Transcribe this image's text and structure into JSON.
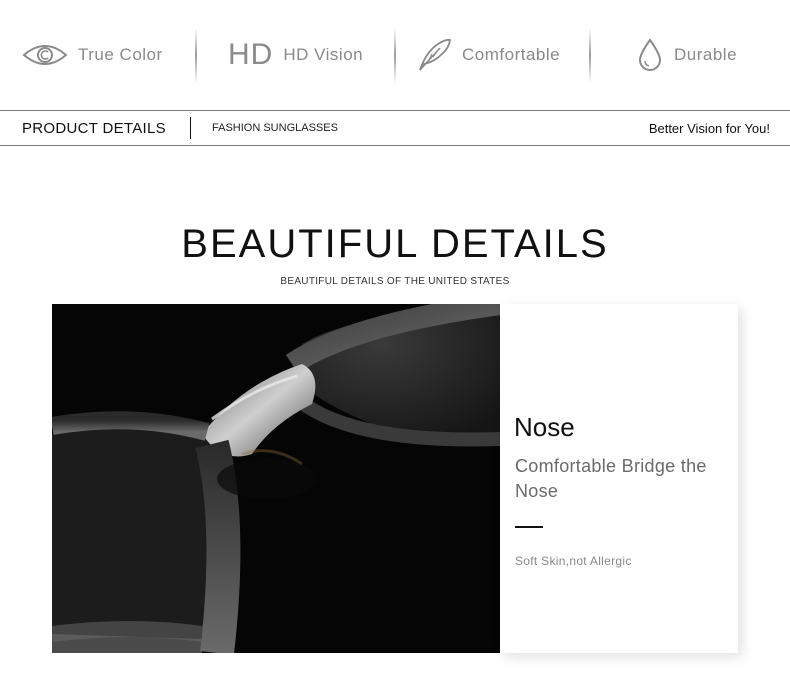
{
  "features": [
    {
      "icon": "eye-icon",
      "label": "True Color"
    },
    {
      "icon": "hd-icon",
      "icon_text": "HD",
      "label": "HD Vision"
    },
    {
      "icon": "feather-icon",
      "label": "Comfortable"
    },
    {
      "icon": "droplet-icon",
      "label": "Durable"
    }
  ],
  "bar": {
    "product_details": "PRODUCT DETAILS",
    "category": "FASHION SUNGLASSES",
    "slogan": "Better Vision for You!"
  },
  "section": {
    "title": "BEAUTIFUL DETAILS",
    "subtitle": "BEAUTIFUL DETAILS OF THE UNITED STATES"
  },
  "card": {
    "title": "Nose",
    "description": "Comfortable Bridge the Nose",
    "note": "Soft Skin,not Allergic"
  },
  "colors": {
    "icon_gray": "#8a8a8a",
    "text_dark": "#111111",
    "photo_bg": "#050505"
  }
}
